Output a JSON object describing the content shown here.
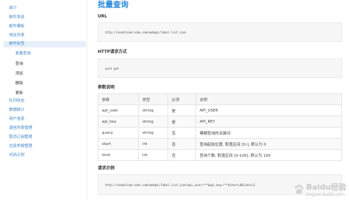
{
  "sidebar": {
    "items": [
      {
        "label": "简介",
        "active": false
      },
      {
        "label": "邮件发送",
        "active": false
      },
      {
        "label": "邮件模板",
        "active": false
      },
      {
        "label": "地址列表",
        "active": false
      },
      {
        "label": "邮件标签",
        "active": true
      }
    ],
    "sub_items": [
      {
        "label": "批量查询",
        "current": true
      },
      {
        "label": "查询",
        "current": false
      },
      {
        "label": "添加",
        "current": false
      },
      {
        "label": "删除",
        "current": false
      },
      {
        "label": "更新",
        "current": false
      }
    ],
    "more_items": [
      {
        "label": "队列状态"
      },
      {
        "label": "数据统计"
      },
      {
        "label": "用户信息"
      },
      {
        "label": "退信列表管理"
      },
      {
        "label": "取消订阅管理"
      },
      {
        "label": "垃圾举报管理"
      },
      {
        "label": "代码示例"
      }
    ]
  },
  "main": {
    "title": "批量查询",
    "url_section": {
      "title": "URL",
      "code": "http://sendcloud.sohu.com/webapi/label.list.json"
    },
    "method_section": {
      "title": "HTTP请求方式",
      "code": "post    get"
    },
    "params_section": {
      "title": "参数说明",
      "headers": [
        "参数",
        "类型",
        "必须",
        "说明"
      ],
      "rows": [
        [
          "api_user",
          "string",
          "是",
          "API_USER"
        ],
        [
          "api_key",
          "string",
          "是",
          "API_KEY"
        ],
        [
          "query",
          "string",
          "否",
          "模糊查询的关键词"
        ],
        [
          "start",
          "int",
          "否",
          "查询起始位置, 取值区间 [0-], 默认为 0"
        ],
        [
          "limit",
          "int",
          "否",
          "查询个数, 取值区间 [0-100], 默认为 100"
        ]
      ]
    },
    "example_section": {
      "title": "请求示例",
      "code": "http://sendcloud.sohu.com/webapi/label.list.json?api_user=***&api_key=***&start=0&limit=2"
    }
  },
  "watermark": {
    "text": "Baidu经验",
    "sub": "jingyan.baidu.com"
  }
}
